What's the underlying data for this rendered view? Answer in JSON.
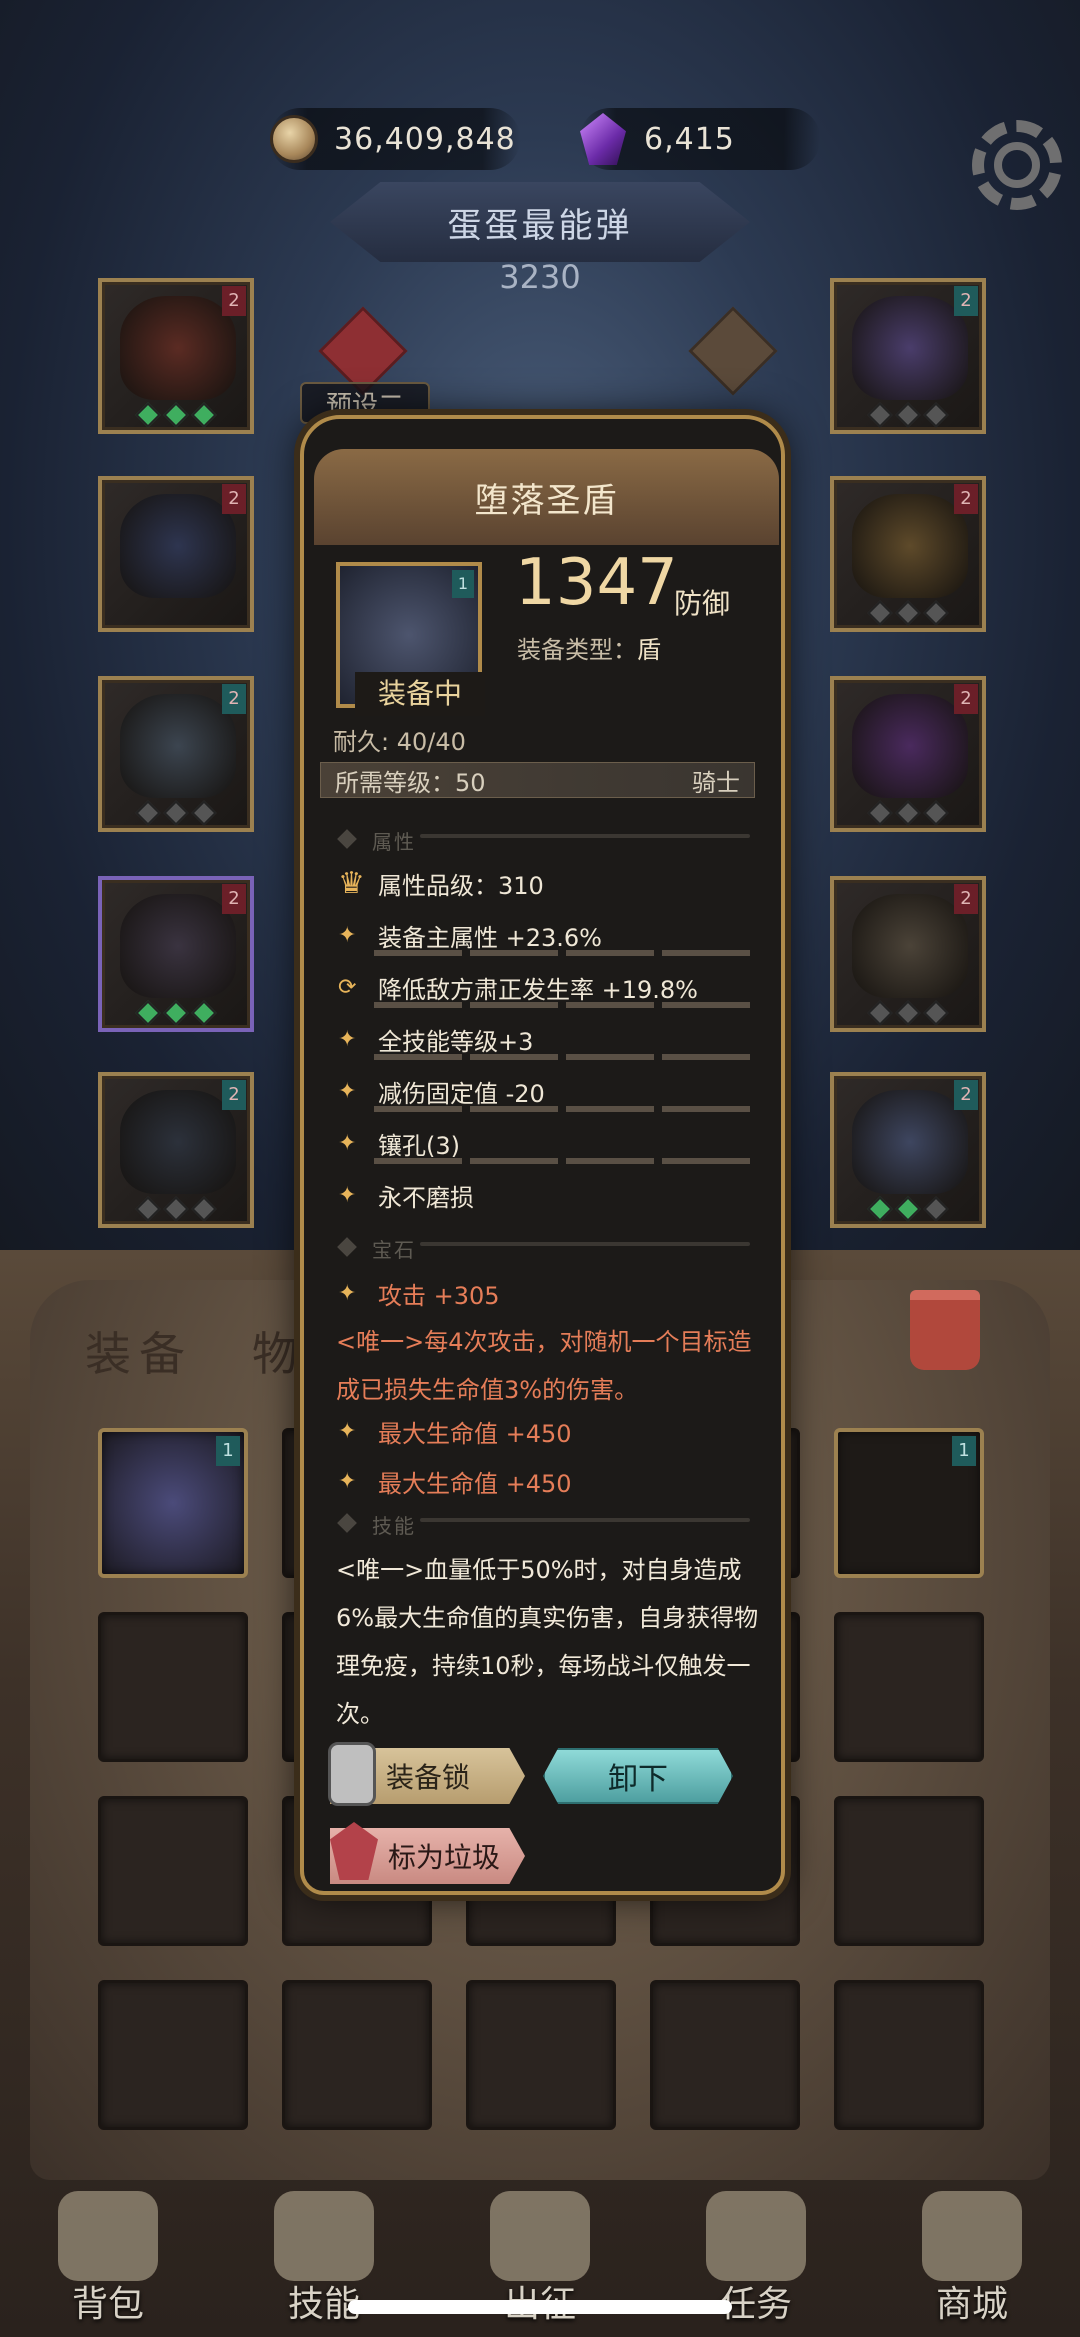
{
  "currency": {
    "gold": "36,409,848",
    "gems": "6,415"
  },
  "team": {
    "name": "蛋蛋最能弹",
    "power": "3230",
    "preset": "预设二"
  },
  "slots_left": [
    {
      "badge": "2",
      "badge_color": "#6b1f28",
      "art": "#5b2b23",
      "dots": [
        "g",
        "g",
        "g"
      ]
    },
    {
      "badge": "2",
      "badge_color": "#6b1f28",
      "art": "#2e3550",
      "dots": []
    },
    {
      "badge": "2",
      "badge_color": "#1f5b5b",
      "art": "#3c4550",
      "dots": [
        "n",
        "n",
        "n"
      ]
    },
    {
      "badge": "2",
      "badge_color": "#6b1f28",
      "art": "#3a3340",
      "dots": [
        "g",
        "g",
        "g"
      ],
      "purple": true
    },
    {
      "badge": "2",
      "badge_color": "#1f5b5b",
      "art": "#2c313b",
      "dots": [
        "n",
        "n",
        "n"
      ]
    }
  ],
  "slots_right": [
    {
      "badge": "2",
      "badge_color": "#1f5b5b",
      "art": "#4a3d6b",
      "dots": [
        "n",
        "n",
        "n"
      ]
    },
    {
      "badge": "2",
      "badge_color": "#6b1f28",
      "art": "#5e4a2a",
      "dots": [
        "n",
        "n",
        "n"
      ]
    },
    {
      "badge": "2",
      "badge_color": "#6b1f28",
      "art": "#4a2a5e",
      "dots": [
        "n",
        "n",
        "n"
      ]
    },
    {
      "badge": "2",
      "badge_color": "#6b1f28",
      "art": "#4b4338",
      "dots": [
        "n",
        "n",
        "n"
      ]
    },
    {
      "badge": "2",
      "badge_color": "#1f5b5b",
      "art": "#3e4660",
      "dots": [
        "g",
        "g",
        "n"
      ]
    }
  ],
  "tabs": {
    "equipment": "装备",
    "items": "物"
  },
  "popup": {
    "name": "堕落圣盾",
    "badge": "1",
    "equipped_label": "装备中",
    "stat_value": "1347",
    "stat_unit": "防御",
    "type_label": "装备类型：",
    "type_value": "盾",
    "durability": "耐久: 40/40",
    "req_level": "所需等级：50",
    "req_class": "骑士",
    "section_attr": "属性",
    "attr_grade": "属性品级：310",
    "attrs": [
      "装备主属性 +23.6%",
      "降低敌方肃正发生率 +19.8%",
      "全技能等级+3",
      "减伤固定值 -20",
      "镶孔(3)",
      "永不磨损"
    ],
    "section_gem": "宝石",
    "gem_attrs": [
      "攻击 +305",
      "最大生命值 +450",
      "最大生命值 +450"
    ],
    "unique_1": "<唯一>每4次攻击，对随机一个目标造成已损失生命值3%的伤害。",
    "section_skill": "技能",
    "unique_2": "<唯一>血量低于50%时，对自身造成6%最大生命值的真实伤害，自身获得物理免疫，持续10秒，每场战斗仅触发一次。",
    "btn_lock": "装备锁",
    "btn_unequip": "卸下",
    "btn_trash": "标为垃圾"
  },
  "bag_first_row": [
    {
      "badge": "1"
    },
    {
      "badge": "1"
    }
  ],
  "nav": [
    {
      "label": "背包",
      "icon": "bag-icon"
    },
    {
      "label": "技能",
      "icon": "skill-book-icon"
    },
    {
      "label": "出征",
      "icon": "sword-icon"
    },
    {
      "label": "任务",
      "icon": "scroll-icon"
    },
    {
      "label": "商城",
      "icon": "shop-icon"
    }
  ]
}
